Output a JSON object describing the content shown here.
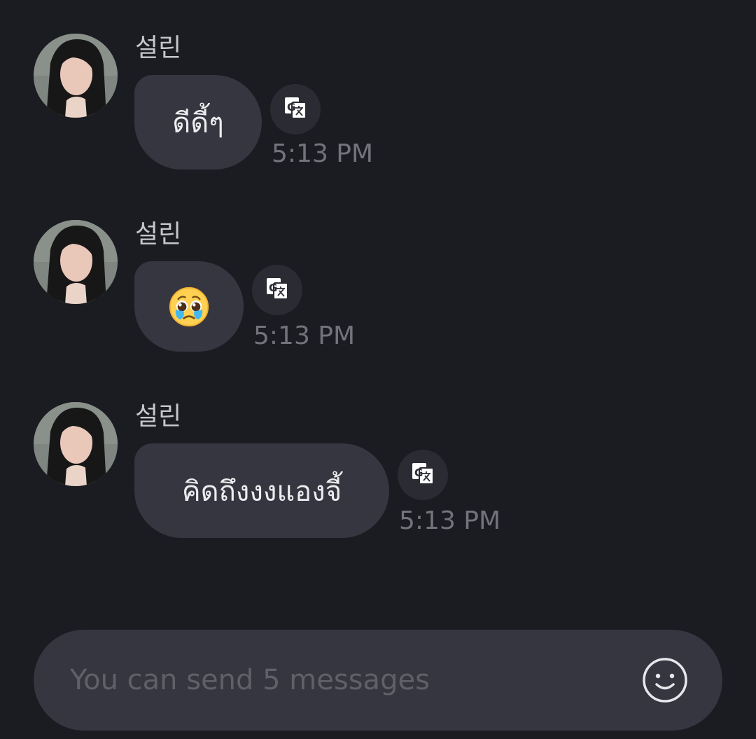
{
  "messages": [
    {
      "sender": "설린",
      "text": "ดีดี้ๆ",
      "time": "5:13 PM",
      "translate_icon": "google-translate-icon"
    },
    {
      "sender": "설린",
      "text": "",
      "emoji": "pleading-face-with-tears-emoji",
      "time": "5:13 PM",
      "translate_icon": "google-translate-icon"
    },
    {
      "sender": "설린",
      "text": "คิดถึงงงแองจี้",
      "time": "5:13 PM",
      "translate_icon": "google-translate-icon"
    }
  ],
  "composer": {
    "placeholder": "You can send 5 messages",
    "value": "",
    "emoji_icon": "smiley-icon"
  },
  "colors": {
    "background": "#1b1c21",
    "bubble": "#35363f",
    "sender": "#c6c7cc",
    "time": "#73747b",
    "placeholder": "#5f6068"
  }
}
